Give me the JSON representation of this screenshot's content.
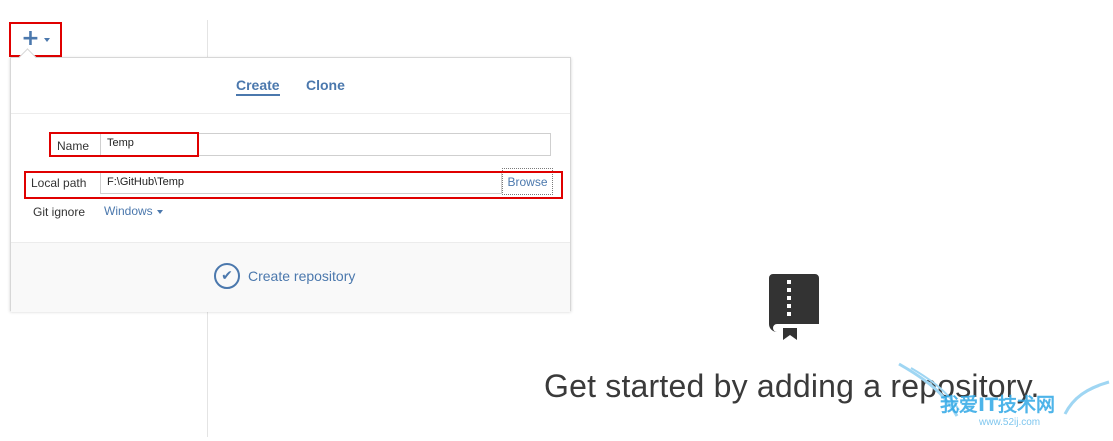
{
  "toolbar": {
    "add_icon": "plus-icon",
    "add_glyph": "+"
  },
  "popover": {
    "tabs": [
      {
        "label": "Create",
        "active": true
      },
      {
        "label": "Clone",
        "active": false
      }
    ],
    "form": {
      "name_label": "Name",
      "name_value": "Temp",
      "local_path_label": "Local path",
      "local_path_value": "F:\\GitHub\\Temp",
      "browse_label": "Browse",
      "git_ignore_label": "Git ignore",
      "git_ignore_value": "Windows"
    },
    "submit": {
      "label": "Create repository",
      "icon": "check-circle-icon",
      "glyph": "✔"
    }
  },
  "empty_state": {
    "icon": "book-icon",
    "message": "Get started by adding a repository."
  },
  "watermark": {
    "text": "我爱IT技术网",
    "url": "www.52ij.com"
  },
  "colors": {
    "accent": "#4b78ad",
    "highlight": "#e00000"
  }
}
